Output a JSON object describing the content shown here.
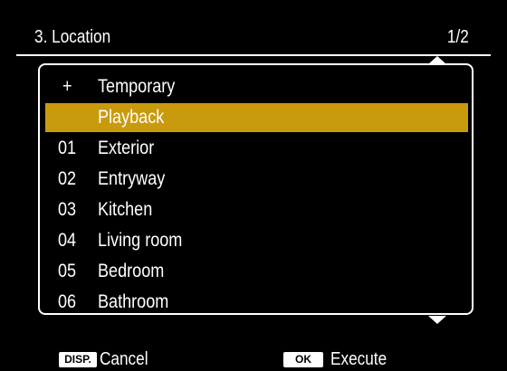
{
  "header": {
    "title": "3. Location",
    "page_indicator": "1/2"
  },
  "list": {
    "items": [
      {
        "num": "+",
        "label": "Temporary",
        "selected": false
      },
      {
        "num": "",
        "label": "Playback",
        "selected": true
      },
      {
        "num": "01",
        "label": "Exterior",
        "selected": false
      },
      {
        "num": "02",
        "label": "Entryway",
        "selected": false
      },
      {
        "num": "03",
        "label": "Kitchen",
        "selected": false
      },
      {
        "num": "04",
        "label": "Living room",
        "selected": false
      },
      {
        "num": "05",
        "label": "Bedroom",
        "selected": false
      },
      {
        "num": "06",
        "label": "Bathroom",
        "selected": false
      }
    ],
    "scroll_up_icon": "triangle-up-icon",
    "scroll_down_icon": "triangle-down-icon"
  },
  "footer": {
    "disp_key": "DISP.",
    "cancel_label": "Cancel",
    "ok_key": "OK",
    "execute_label": "Execute"
  },
  "colors": {
    "background": "#000000",
    "foreground": "#ffffff",
    "highlight": "#c99a0c"
  }
}
